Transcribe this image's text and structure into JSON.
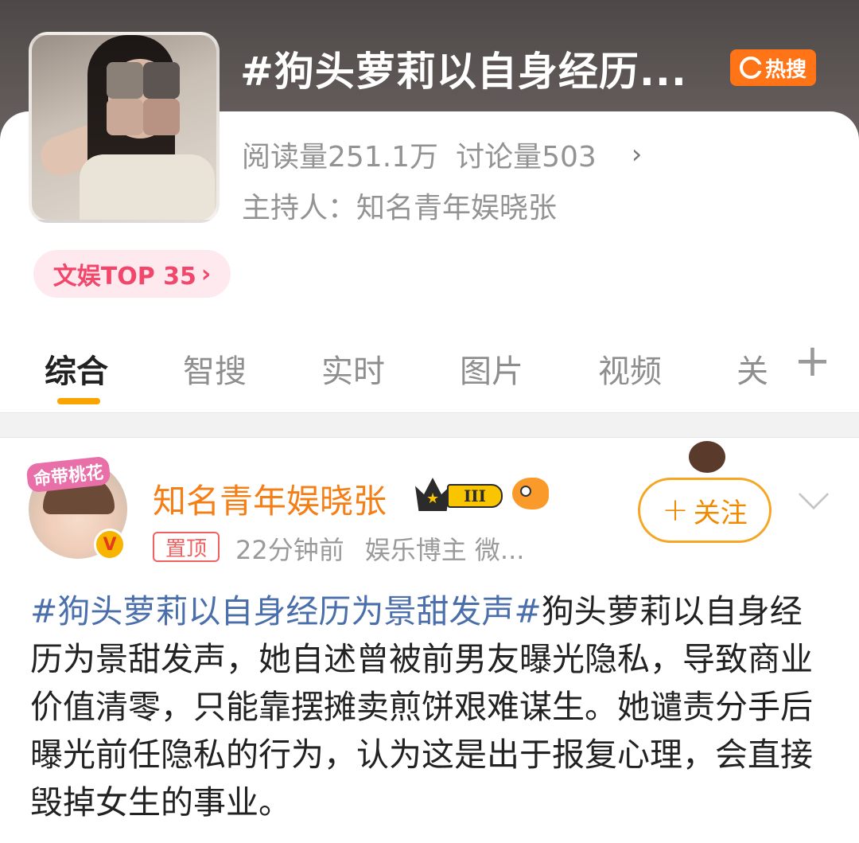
{
  "topic": {
    "title": "#狗头萝莉以自身经历...",
    "hot_badge": "热搜",
    "reads": "阅读量251.1万",
    "discussions": "讨论量503",
    "chevron": "›",
    "host": "主持人：知名青年娱晓张",
    "rank": "文娱TOP 35",
    "rank_chevron": "›"
  },
  "tabs": {
    "items": [
      {
        "label": "综合",
        "active": true
      },
      {
        "label": "智搜"
      },
      {
        "label": "实时"
      },
      {
        "label": "图片"
      },
      {
        "label": "视频"
      },
      {
        "label": "关"
      }
    ],
    "add": "+"
  },
  "post": {
    "avatar_frame_text": "命带桃花",
    "verify_mark": "V",
    "username": "知名青年娱晓张",
    "level": "III",
    "pin": "置顶",
    "time": "22分钟前",
    "category": "娱乐博主 微...",
    "follow": "关注",
    "follow_plus": "+",
    "hashtag": "#狗头萝莉以自身经历为景甜发声#",
    "text": "狗头萝莉以自身经历为景甜发声，她自述曾被前男友曝光隐私，导致商业价值清零，只能靠摆摊卖煎饼艰难谋生。她谴责分手后曝光前任隐私的行为，认为这是出于报复心理，会直接毁掉女生的事业。"
  },
  "colors": {
    "accent_orange": "#f57f17",
    "hot_orange": "#ff7417",
    "rank_pink": "#f2466a",
    "hashtag_blue": "#4b6faa",
    "tab_underline": "#f9a400"
  }
}
